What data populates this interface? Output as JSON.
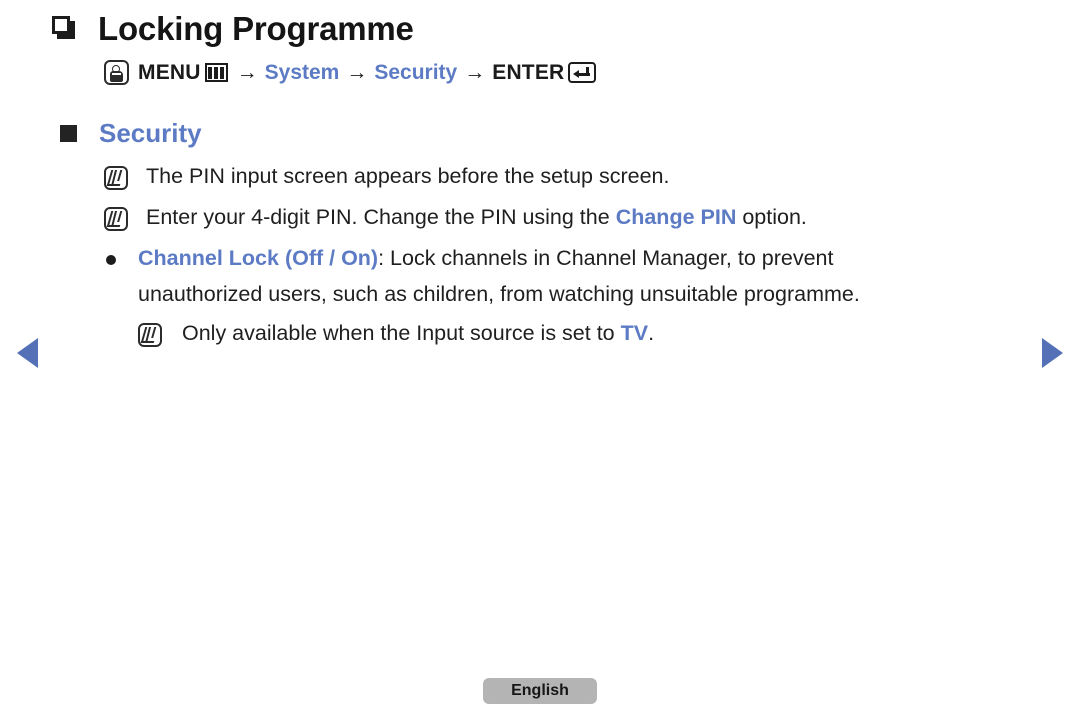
{
  "page": {
    "title": "Locking Programme",
    "title_bullet_icon": "square-outline-icon",
    "language_button": "English"
  },
  "menu_path": {
    "press_icon": "press-button-icon",
    "menu_label": "MENU",
    "menu_icon": "menu-grid-icon",
    "arrow": "→",
    "step_system": "System",
    "step_security": "Security",
    "enter_label": "ENTER",
    "enter_icon": "enter-return-icon"
  },
  "section": {
    "bullet_icon": "filled-square-icon",
    "heading": "Security"
  },
  "notes": [
    {
      "icon": "note-pencil-icon",
      "text": "The PIN input screen appears before the setup screen."
    },
    {
      "icon": "note-pencil-icon",
      "text_before": "Enter your 4-digit PIN. Change the PIN using the ",
      "highlight": "Change PIN",
      "text_after": " option."
    }
  ],
  "bullet_item": {
    "icon": "round-bullet-icon",
    "highlight": "Channel Lock (Off / On)",
    "text_after": ": Lock channels in Channel Manager, to prevent",
    "continuation": "unauthorized users, such as children, from watching unsuitable programme.",
    "sub_note": {
      "icon": "note-pencil-icon",
      "text_before": "Only available when the Input source is set to ",
      "highlight": "TV",
      "text_after": "."
    }
  },
  "navigation": {
    "prev_icon": "arrow-left-icon",
    "next_icon": "arrow-right-icon"
  },
  "colors": {
    "accent_blue": "#5c7bc4",
    "nav_blue": "#5471b8",
    "text": "#1f1f1f",
    "button_gray": "#b4b4b4"
  }
}
